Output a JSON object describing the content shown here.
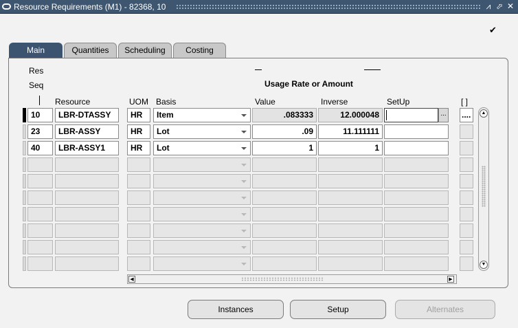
{
  "window": {
    "title": "Resource Requirements (M1) - 82368, 10",
    "controls": {
      "minimize": "⩘",
      "maximize": "⬀",
      "close": "✕"
    }
  },
  "header": {
    "checkbox_mark": "✔"
  },
  "tabs": [
    {
      "label": "Main",
      "active": true
    },
    {
      "label": "Quantities",
      "active": false
    },
    {
      "label": "Scheduling",
      "active": false
    },
    {
      "label": "Costing",
      "active": false
    }
  ],
  "grid": {
    "res_seq_label_1": "Res",
    "res_seq_label_2": "Seq",
    "group_header": "Usage Rate or Amount",
    "columns": {
      "resource": "Resource",
      "uom": "UOM",
      "basis": "Basis",
      "value": "Value",
      "inverse": "Inverse",
      "setup": "SetUp",
      "flex": "[ ]"
    },
    "rows": [
      {
        "seq": "10",
        "resource": "LBR-DTASSY",
        "uom": "HR",
        "basis": "Item",
        "value": ".083333",
        "inverse": "12.000048",
        "setup": "",
        "flex": "...."
      },
      {
        "seq": "23",
        "resource": "LBR-ASSY",
        "uom": "HR",
        "basis": "Lot",
        "value": ".09",
        "inverse": "11.111111",
        "setup": "",
        "flex": ""
      },
      {
        "seq": "40",
        "resource": "LBR-ASSY1",
        "uom": "HR",
        "basis": "Lot",
        "value": "1",
        "inverse": "1",
        "setup": "",
        "flex": ""
      }
    ],
    "lov_button": "..."
  },
  "scroll": {
    "up": "▲",
    "down": "▼",
    "left": "◀",
    "right": "▶"
  },
  "buttons": {
    "instances": "Instances",
    "setup": "Setup",
    "alternates": "Alternates"
  },
  "colors": {
    "titlebar": "#3f5670",
    "active_tab": "#3d5470",
    "background": "#f2f2f2"
  }
}
